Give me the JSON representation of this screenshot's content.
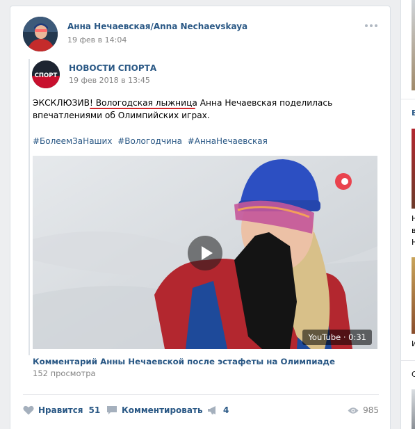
{
  "post": {
    "author": "Анна Нечаевская/Anna Nechaevskaya",
    "date": "19 фев в 14:04",
    "repost": {
      "source": "НОВОСТИ СПОРТА",
      "date": "19 фев 2018 в 13:45",
      "avatar_text": "СПОРТ",
      "text": "ЭКСКЛЮЗИВ! Вологодская лыжница Анна Нечаевская поделилась впечатлениями об Олимпийских играх.",
      "hashtags": [
        "#БолеемЗаНаших",
        "#Вологодчина",
        "#АннаНечаевская"
      ]
    },
    "video": {
      "badge": "YouTube · 0:31",
      "title": "Комментарий Анны Нечаевской после эстафеты на Олимпиаде",
      "views": "152 просмотра"
    },
    "actions": {
      "like_label": "Нравится",
      "like_count": "51",
      "comment_label": "Комментировать",
      "share_count": "4",
      "views_count": "985"
    }
  },
  "right_column": {
    "letters": [
      "В",
      "Н",
      "в",
      "Н",
      "И",
      "С"
    ]
  },
  "colors": {
    "link": "#2a5885",
    "muted": "#828282",
    "underline": "#d2282b",
    "background": "#edeef0"
  },
  "icons": [
    "more-icon",
    "play-icon",
    "heart-icon",
    "comment-icon",
    "megaphone-icon",
    "eye-icon"
  ]
}
